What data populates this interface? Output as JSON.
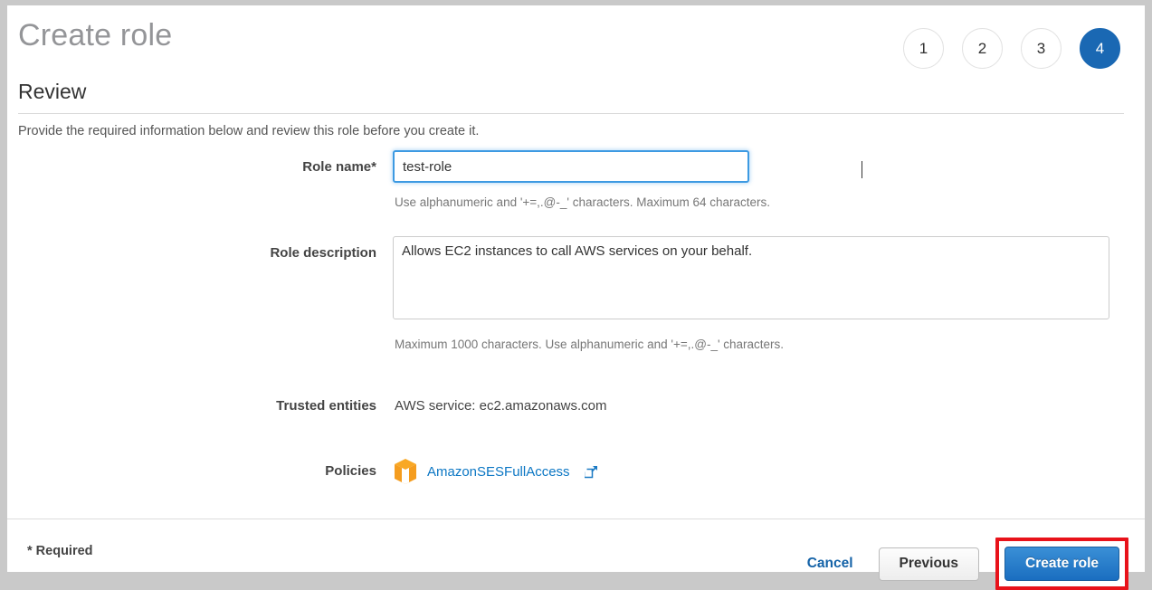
{
  "wizard": {
    "title": "Create role",
    "steps": [
      {
        "label": "1",
        "active": false
      },
      {
        "label": "2",
        "active": false
      },
      {
        "label": "3",
        "active": false
      },
      {
        "label": "4",
        "active": true
      }
    ],
    "section_title": "Review",
    "intro": "Provide the required information below and review this role before you create it."
  },
  "form": {
    "role_name": {
      "label": "Role name*",
      "value": "test-role",
      "placeholder": "",
      "hint": "Use alphanumeric and '+=,.@-_' characters. Maximum 64 characters."
    },
    "role_description": {
      "label": "Role description",
      "value": "Allows EC2 instances to call AWS services on your behalf.",
      "placeholder": "",
      "hint": "Maximum 1000 characters. Use alphanumeric and '+=,.@-_' characters."
    },
    "trusted_entities": {
      "label": "Trusted entities",
      "value": "AWS service: ec2.amazonaws.com"
    },
    "policies": {
      "label": "Policies",
      "icon": "policy-cube-icon",
      "link_text": "AmazonSESFullAccess",
      "external_icon": "external-link-icon"
    }
  },
  "footer": {
    "required_note": "* Required",
    "cancel_label": "Cancel",
    "previous_label": "Previous",
    "create_label": "Create role"
  },
  "colors": {
    "accent_blue": "#1a68b3",
    "link_blue": "#0c77c4",
    "policy_orange": "#f59d1f",
    "highlight_red": "#e8121a"
  }
}
